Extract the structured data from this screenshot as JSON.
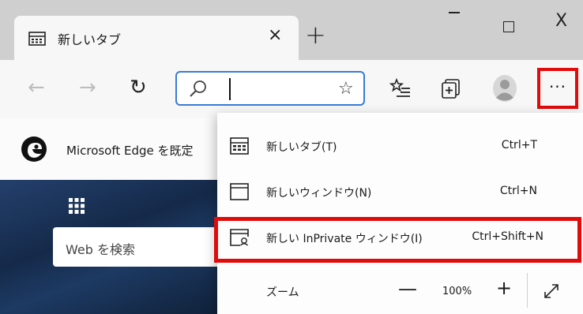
{
  "tab": {
    "title": "新しいタブ",
    "close_glyph": "×"
  },
  "tabbar": {
    "new_tab_glyph": "+",
    "close_glyph": "X"
  },
  "toolbar": {
    "back_glyph": "←",
    "forward_glyph": "→",
    "refresh_glyph": "↻",
    "address_value": "",
    "star_glyph": "☆",
    "more_glyph": "···"
  },
  "icons": {
    "tab_favicon": "new-tab-page-icon",
    "search": "search-icon",
    "favorites_list": "favorites-list-icon",
    "collections": "collections-icon",
    "profile": "profile-avatar-icon",
    "edge_logo": "microsoft-edge-logo",
    "apps": "app-launcher-icon",
    "new_window": "window-icon",
    "inprivate": "inprivate-window-icon",
    "fullscreen": "fullscreen-icon"
  },
  "content": {
    "infobar_text": "Microsoft Edge を既定",
    "search_placeholder": "Web を検索"
  },
  "menu": {
    "items": [
      {
        "label": "新しいタブ(T)",
        "shortcut": "Ctrl+T"
      },
      {
        "label": "新しいウィンドウ(N)",
        "shortcut": "Ctrl+N"
      },
      {
        "label": "新しい InPrivate ウィンドウ(I)",
        "shortcut": "Ctrl+Shift+N"
      }
    ],
    "zoom": {
      "label": "ズーム",
      "minus": "—",
      "value": "100%",
      "plus": "+"
    }
  },
  "colors": {
    "highlight": "#e10b0b",
    "address_border": "#3a7bd5",
    "tabbar_bg": "#cfcfcf"
  }
}
